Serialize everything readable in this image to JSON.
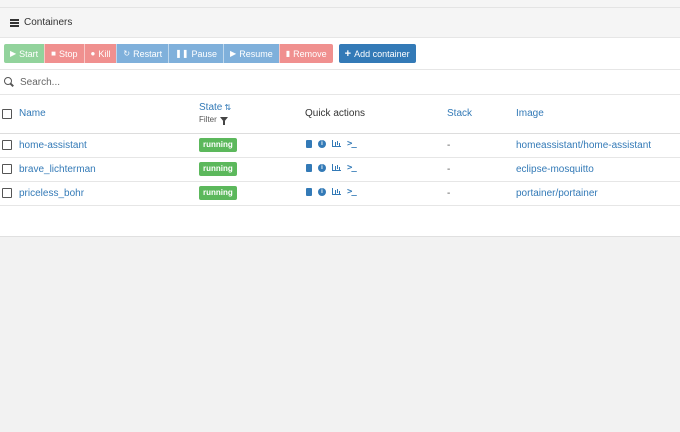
{
  "panel": {
    "title": "Containers"
  },
  "toolbar": {
    "start": "Start",
    "stop": "Stop",
    "kill": "Kill",
    "restart": "Restart",
    "pause": "Pause",
    "resume": "Resume",
    "remove": "Remove",
    "add": "Add container"
  },
  "search": {
    "placeholder": "Search..."
  },
  "table": {
    "headers": {
      "name": "Name",
      "state": "State",
      "filter": "Filter",
      "actions": "Quick actions",
      "stack": "Stack",
      "image": "Image"
    },
    "rows": [
      {
        "name": "home-assistant",
        "state": "running",
        "stack": "-",
        "image": "homeassistant/home-assistant"
      },
      {
        "name": "brave_lichterman",
        "state": "running",
        "stack": "-",
        "image": "eclipse-mosquitto"
      },
      {
        "name": "priceless_bohr",
        "state": "running",
        "stack": "-",
        "image": "portainer/portainer"
      }
    ]
  },
  "colors": {
    "accent": "#337ab7",
    "running": "#5cb85c",
    "start": "#92d39c",
    "danger": "#f0908f",
    "info": "#7fb0db"
  },
  "icons": {
    "header": "list-icon",
    "actions": [
      "logs-icon",
      "inspect-icon",
      "stats-icon",
      "console-icon"
    ]
  }
}
